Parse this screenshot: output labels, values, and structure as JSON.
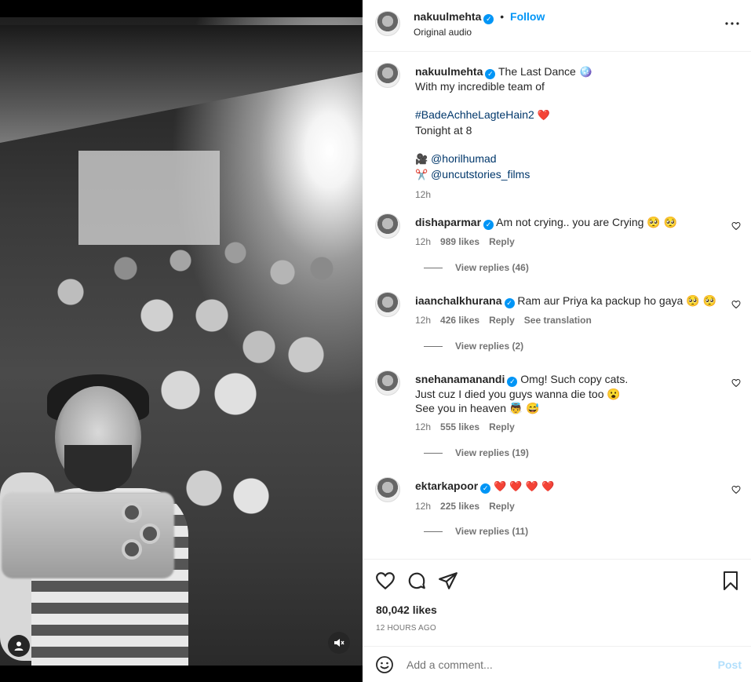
{
  "media": {
    "profile_icon": "person-icon",
    "mute_icon": "speaker-muted-icon"
  },
  "header": {
    "username": "nakuulmehta",
    "dot": "•",
    "follow_label": "Follow",
    "subtitle": "Original audio",
    "more_icon": "more-options-icon"
  },
  "caption": {
    "username": "nakuulmehta",
    "line1": "The Last Dance 🪩",
    "line2": "With my incredible team of",
    "hashtag": "#BadeAchheLagteHain2",
    "heart": "❤️",
    "line4": "Tonight at 8",
    "camera_emoji": "🎥",
    "mention1": "@horilhumad",
    "scissors_emoji": "✂️",
    "mention2": "@uncutstories_films",
    "time": "12h"
  },
  "comments": [
    {
      "username": "dishaparmar",
      "text": "Am not crying.. you are Crying 🥺 🥺",
      "time": "12h",
      "likes": "989 likes",
      "reply": "Reply",
      "extra": "",
      "view_replies": "View replies (46)"
    },
    {
      "username": "iaanchalkhurana",
      "text": "Ram aur Priya ka packup ho gaya 🥺 🥺",
      "time": "12h",
      "likes": "426 likes",
      "reply": "Reply",
      "extra": "See translation",
      "view_replies": "View replies (2)"
    },
    {
      "username": "snehanamanandi",
      "text": "Omg! Such copy cats.",
      "text2": "Just cuz I died you guys wanna die too 😮",
      "text3": "See you in heaven 👼 😅",
      "time": "12h",
      "likes": "555 likes",
      "reply": "Reply",
      "extra": "",
      "view_replies": "View replies (19)"
    },
    {
      "username": "ektarkapoor",
      "text": "❤️ ❤️ ❤️ ❤️",
      "time": "12h",
      "likes": "225 likes",
      "reply": "Reply",
      "extra": "",
      "view_replies": "View replies (11)"
    }
  ],
  "actions": {
    "like_icon": "heart-icon",
    "comment_icon": "comment-icon",
    "share_icon": "send-icon",
    "save_icon": "bookmark-icon",
    "likes": "80,042 likes",
    "time": "12 HOURS AGO"
  },
  "add_comment": {
    "emoji_icon": "emoji-icon",
    "placeholder": "Add a comment...",
    "post_label": "Post"
  },
  "colors": {
    "accent": "#0095f6",
    "link": "#00376b",
    "heart": "#ed4956"
  }
}
